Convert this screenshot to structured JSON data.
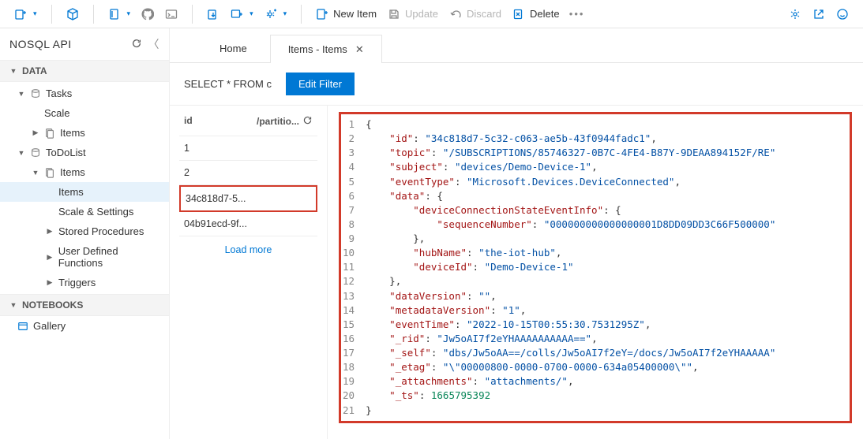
{
  "toolbar": {
    "new_item": "New Item",
    "update": "Update",
    "discard": "Discard",
    "delete": "Delete"
  },
  "sidebar": {
    "api_title": "NOSQL API",
    "sections": {
      "data": "DATA",
      "notebooks": "NOTEBOOKS"
    },
    "tree": [
      {
        "label": "Tasks"
      },
      {
        "label": "Scale"
      },
      {
        "label": "Items"
      },
      {
        "label": "ToDoList"
      },
      {
        "label": "Items"
      },
      {
        "label": "Items"
      },
      {
        "label": "Scale & Settings"
      },
      {
        "label": "Stored Procedures"
      },
      {
        "label": "User Defined Functions"
      },
      {
        "label": "Triggers"
      }
    ],
    "gallery": "Gallery"
  },
  "tabs": [
    {
      "label": "Home"
    },
    {
      "label": "Items - Items"
    }
  ],
  "filter": {
    "query": "SELECT * FROM c",
    "edit_label": "Edit Filter"
  },
  "itemlist": {
    "col_id": "id",
    "col_partition": "/partitio...",
    "rows": [
      {
        "id": "1"
      },
      {
        "id": "2"
      },
      {
        "id": "34c818d7-5..."
      },
      {
        "id": "04b91ecd-9f..."
      }
    ],
    "load_more": "Load more"
  },
  "document": {
    "id": "34c818d7-5c32-c063-ae5b-43f0944fadc1",
    "topic": "/SUBSCRIPTIONS/85746327-0B7C-4FE4-B87Y-9DEAA894152F/RE",
    "subject": "devices/Demo-Device-1",
    "eventType": "Microsoft.Devices.DeviceConnected",
    "sequenceNumber": "000000000000000001D8DD09DD3C66F500000",
    "hubName": "the-iot-hub",
    "deviceId": "Demo-Device-1",
    "dataVersion": "",
    "metadataVersion": "1",
    "eventTime": "2022-10-15T00:55:30.7531295Z",
    "_rid": "Jw5oAI7f2eYHAAAAAAAAAA==",
    "_self": "dbs/Jw5oAA==/colls/Jw5oAI7f2eY=/docs/Jw5oAI7f2eYHAAAAA",
    "_etag": "\\\"00000800-0000-0700-0000-634a05400000\\\"",
    "_attachments": "attachments/",
    "_ts": 1665795392
  }
}
